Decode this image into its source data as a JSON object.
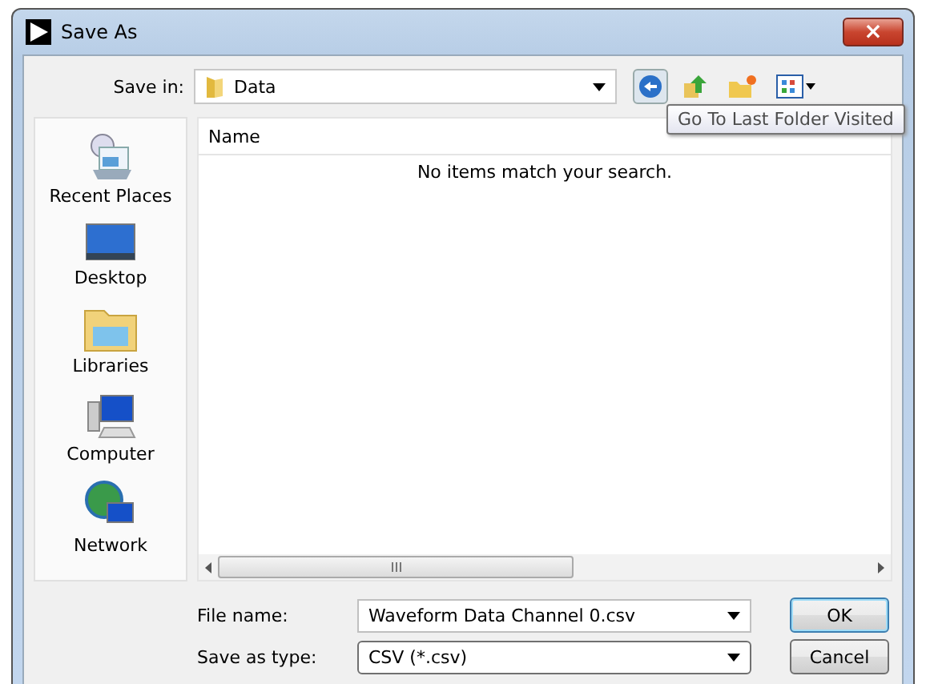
{
  "window": {
    "title": "Save As",
    "close": "×"
  },
  "save_in": {
    "label": "Save in:",
    "value": "Data"
  },
  "tooltip": "Go To Last Folder Visited",
  "places": [
    {
      "label": "Recent Places"
    },
    {
      "label": "Desktop"
    },
    {
      "label": "Libraries"
    },
    {
      "label": "Computer"
    },
    {
      "label": "Network"
    }
  ],
  "file_list": {
    "columns": [
      "Name"
    ],
    "empty_message": "No items match your search."
  },
  "file_name": {
    "label": "File name:",
    "value": "Waveform Data Channel 0.csv"
  },
  "save_as_type": {
    "label": "Save as type:",
    "value": "CSV (*.csv)"
  },
  "buttons": [
    {
      "label": "OK",
      "default": true
    },
    {
      "label": "Cancel",
      "default": false
    }
  ]
}
